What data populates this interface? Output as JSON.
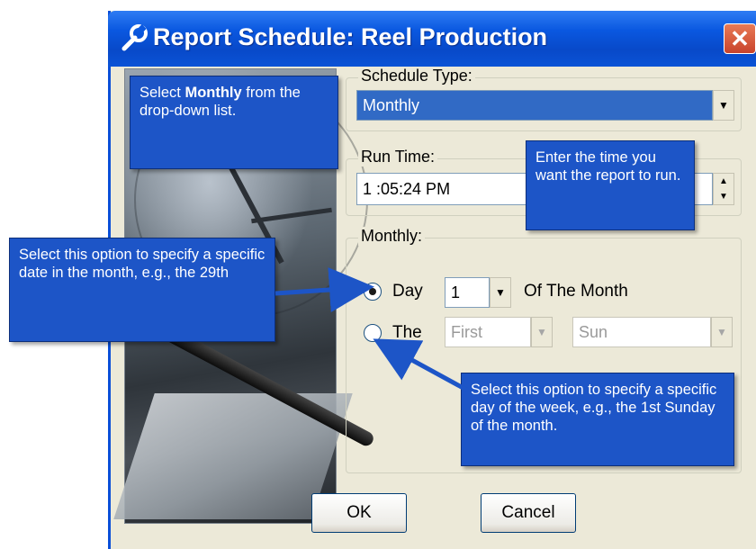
{
  "window": {
    "title": "Report Schedule: Reel Production",
    "close_glyph": "✕"
  },
  "schedule_type": {
    "label": "Schedule Type:",
    "selected": "Monthly"
  },
  "run_time": {
    "label": "Run Time:",
    "value": "1 :05:24 PM"
  },
  "monthly": {
    "label": "Monthly:",
    "option_day": {
      "label": "Day",
      "day_value": "1",
      "suffix": "Of The Month",
      "checked": true
    },
    "option_the": {
      "label": "The",
      "ordinal": "First",
      "weekday": "Sun",
      "checked": false
    }
  },
  "buttons": {
    "ok": "OK",
    "cancel": "Cancel"
  },
  "callouts": {
    "monthly_pre": "Select ",
    "monthly_bold": "Monthly",
    "monthly_post": " from the drop-down list.",
    "run_time": "Enter the time you want the report to run.",
    "day_option": "Select this option to specify a specific date in the month, e.g., the 29th",
    "the_option": "Select this option to specify a specific day of the week, e.g., the 1st Sunday of the month."
  },
  "colors": {
    "callout_blue": "#1d55c7",
    "titlebar_blue": "#0a58e0",
    "selection_blue": "#316ac5",
    "close_red": "#d9553a"
  },
  "icons": {
    "title": "wrench-icon",
    "close": "close-icon",
    "dropdown": "chevron-down-icon",
    "spin": "spin-arrows-icon"
  }
}
